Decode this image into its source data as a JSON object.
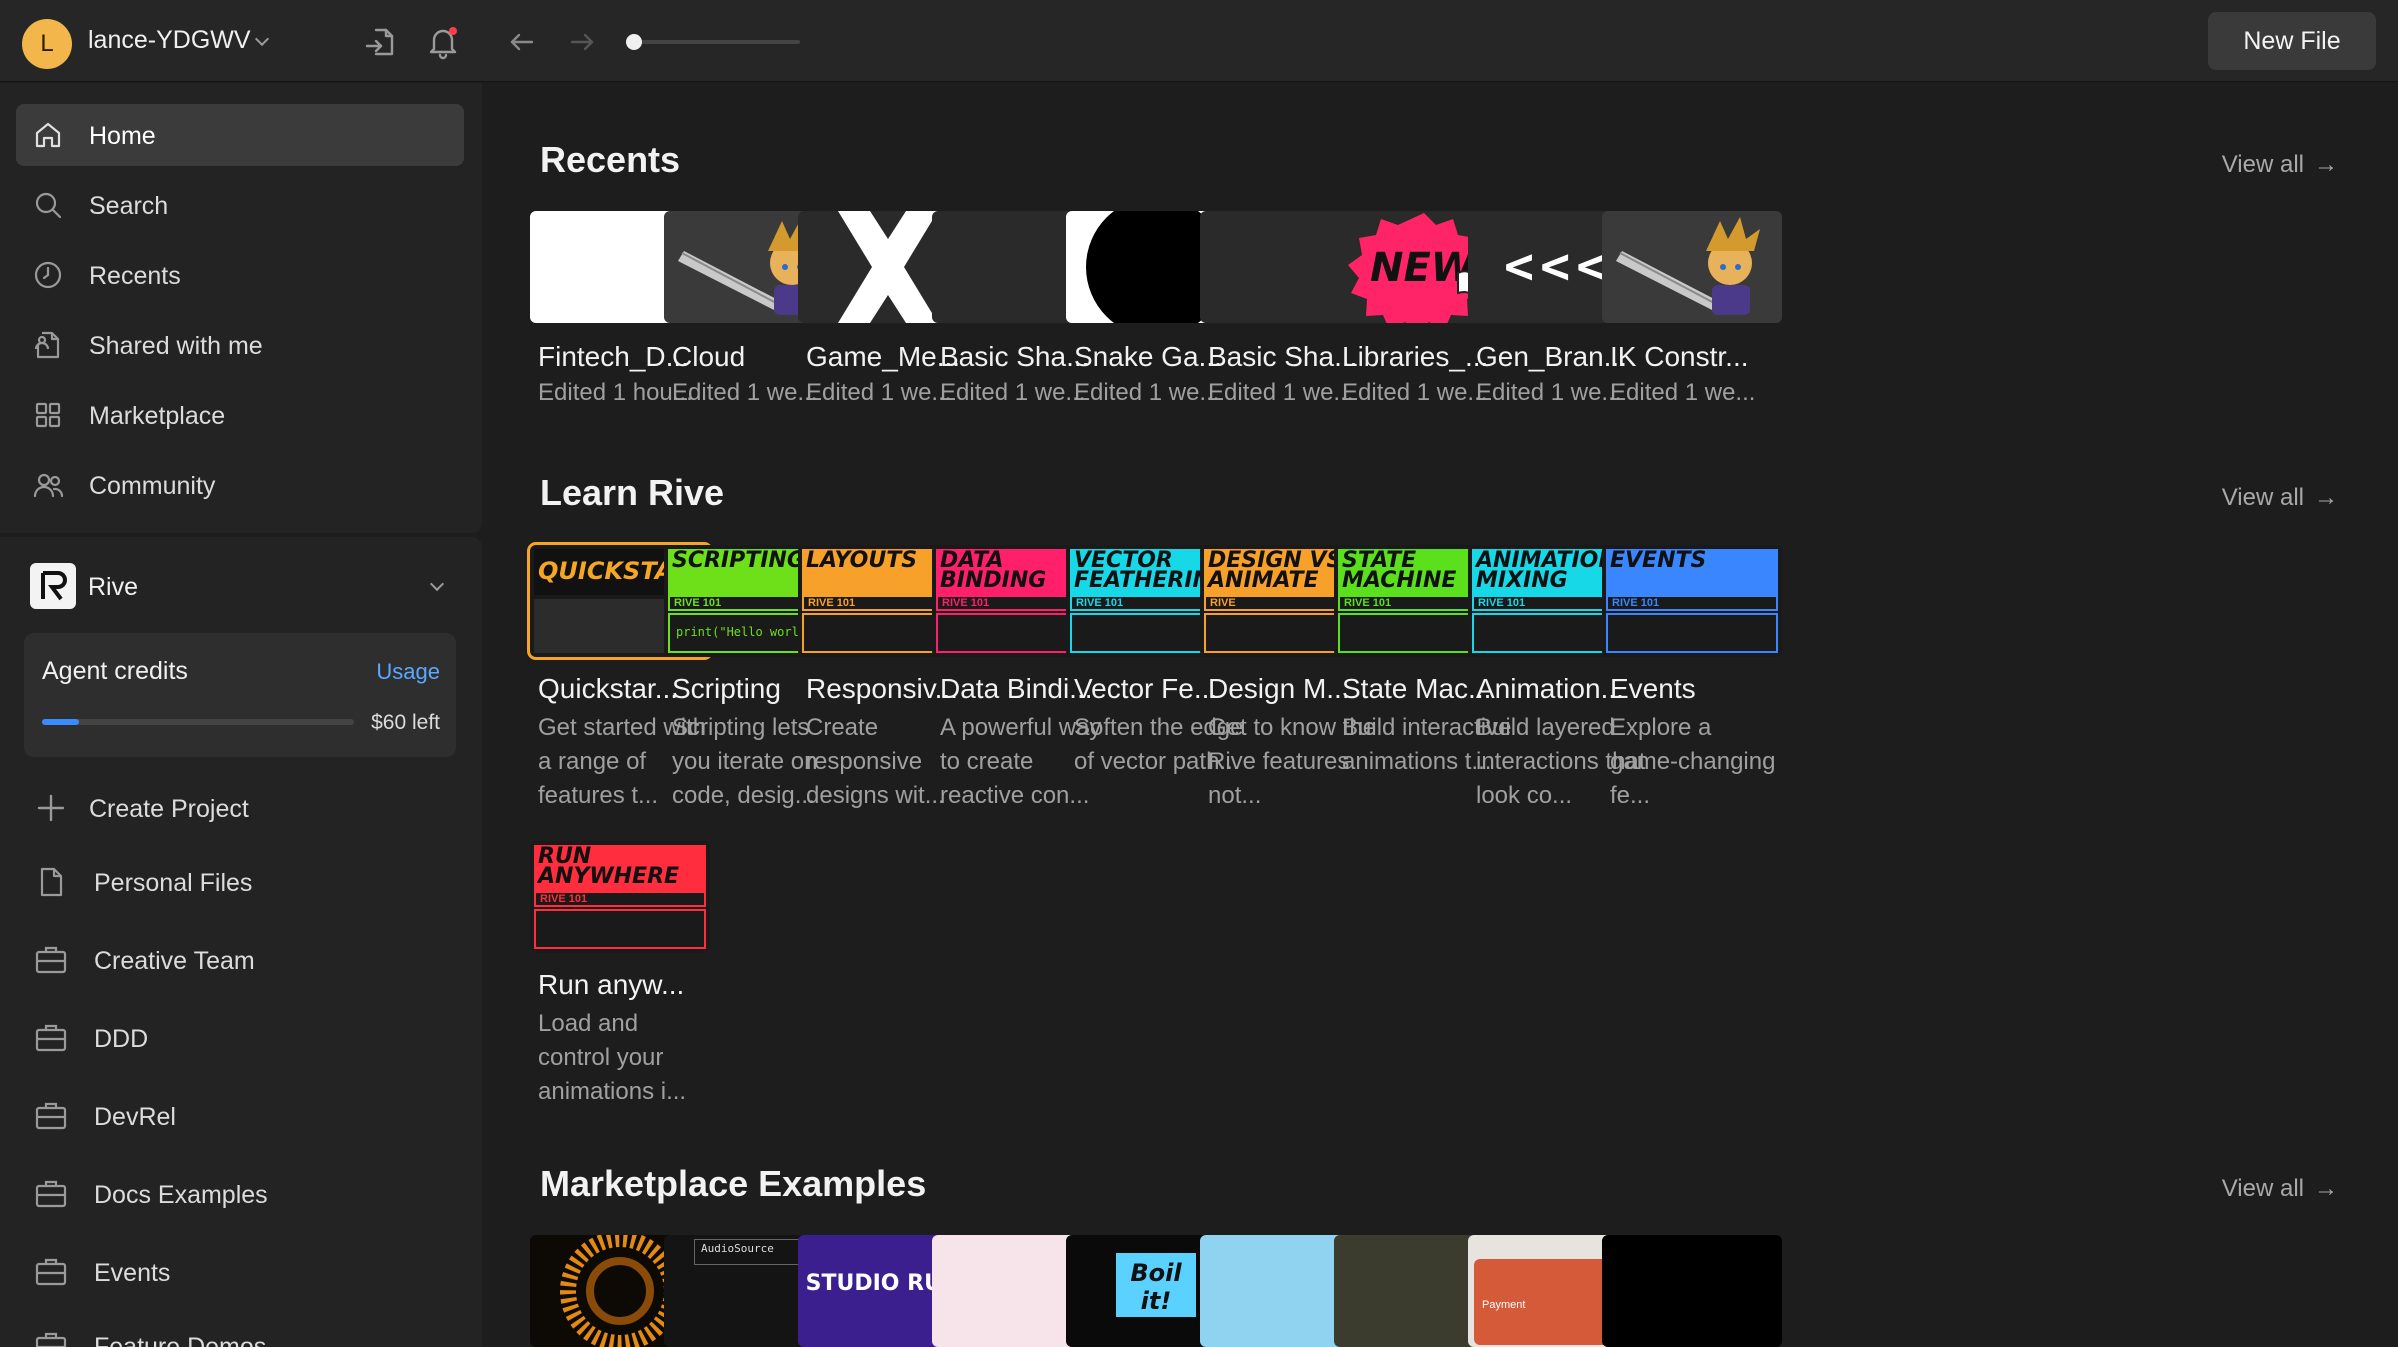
{
  "topbar": {
    "avatar_letter": "L",
    "username": "lance-YDGWV",
    "new_file": "New File",
    "history_progress": 0.05
  },
  "nav": [
    {
      "label": "Home",
      "icon": "home-icon",
      "active": true
    },
    {
      "label": "Search",
      "icon": "search-icon"
    },
    {
      "label": "Recents",
      "icon": "clock-icon"
    },
    {
      "label": "Shared with me",
      "icon": "shared-icon"
    },
    {
      "label": "Marketplace",
      "icon": "grid-icon"
    },
    {
      "label": "Community",
      "icon": "users-icon"
    }
  ],
  "workspace": {
    "name": "Rive",
    "credits": {
      "title": "Agent credits",
      "usage_link": "Usage",
      "remaining": "$60 left",
      "fraction_used": 0.12
    },
    "items": [
      "Create Project",
      "Personal Files",
      "Creative Team",
      "DDD",
      "DevRel",
      "Docs Examples",
      "Events",
      "Feature Demos"
    ]
  },
  "sections": {
    "recents": {
      "title": "Recents",
      "view_all": "View all"
    },
    "learn": {
      "title": "Learn Rive",
      "view_all": "View all"
    },
    "marketplace": {
      "title": "Marketplace Examples",
      "view_all": "View all"
    }
  },
  "recents": [
    {
      "title": "Fintech_D...",
      "sub": "Edited 1 hou...",
      "thumb": "white"
    },
    {
      "title": "Cloud",
      "sub": "Edited 1 we...",
      "thumb": "character"
    },
    {
      "title": "Game_Me...",
      "sub": "Edited 1 we...",
      "thumb": "x"
    },
    {
      "title": "Basic Sha...",
      "sub": "Edited 1 we...",
      "thumb": "blank"
    },
    {
      "title": "Snake Ga...",
      "sub": "Edited 1 we...",
      "thumb": "circle"
    },
    {
      "title": "Basic Sha...",
      "sub": "Edited 1 we...",
      "thumb": "blank"
    },
    {
      "title": "Libraries_...",
      "sub": "Edited 1 we...",
      "thumb": "new"
    },
    {
      "title": "Gen_Bran...",
      "sub": "Edited 1 we...",
      "thumb": "chevrons"
    },
    {
      "title": "IK Constr...",
      "sub": "Edited 1 we...",
      "thumb": "character"
    }
  ],
  "recents_thumb_text": {
    "new_badge": "NEW",
    "chevrons": "<<<"
  },
  "learn": [
    {
      "banner": "QUICKSTART",
      "title": "Quickstar...",
      "desc": "Get started with a range of features t...",
      "color": "#f5a623",
      "strip": "",
      "selected": true
    },
    {
      "banner": "SCRIPTING",
      "title": "Scripting",
      "desc": "Scripting lets you iterate on code, desig...",
      "color": "#6de01a",
      "strip": "RIVE 101",
      "code": "print(\"Hello world!\")"
    },
    {
      "banner": "LAYOUTS",
      "title": "Responsiv...",
      "desc": "Create responsive designs wit...",
      "color": "#f7a02a",
      "strip": "RIVE 101"
    },
    {
      "banner": "DATA BINDING",
      "title": "Data Bindi...",
      "desc": "A powerful way to create reactive con...",
      "color": "#ff1f6b",
      "strip": "RIVE 101"
    },
    {
      "banner": "VECTOR FEATHERING",
      "title": "Vector Fe...",
      "desc": "Soften the edge of vector path...",
      "color": "#17d8e6",
      "strip": "RIVE 101"
    },
    {
      "banner": "DESIGN VS ANIMATE",
      "title": "Design M...",
      "desc": "Get to know the Rive features not...",
      "color": "#f7a02a",
      "strip": "RIVE"
    },
    {
      "banner": "STATE MACHINE",
      "title": "State Mac...",
      "desc": "Build interactive animations t...",
      "color": "#5be01e",
      "strip": "RIVE 101"
    },
    {
      "banner": "ANIMATION MIXING",
      "title": "Animation...",
      "desc": "Build layered interactions that look co...",
      "color": "#17d8e6",
      "strip": "RIVE 101"
    },
    {
      "banner": "EVENTS",
      "title": "Events",
      "desc": "Explore a game-changing fe...",
      "color": "#3a86ff",
      "strip": "RIVE 101"
    },
    {
      "banner": "RUN ANYWHERE",
      "title": "Run anyw...",
      "desc": "Load and control your animations i...",
      "color": "#ff2d3d",
      "strip": "RIVE 101"
    }
  ],
  "marketplace_thumbs": [
    {
      "label": "",
      "bg": "#0d0a05"
    },
    {
      "label": "AudioSource",
      "bg": "#141414"
    },
    {
      "label": "STUDIO RUN!",
      "bg": "#3b1f8f"
    },
    {
      "label": "",
      "bg": "#f7e3ea"
    },
    {
      "label": "Boil it!",
      "bg": "#0a0a0a"
    },
    {
      "label": "",
      "bg": "#8fd3f0"
    },
    {
      "label": "",
      "bg": "#3c3c2e"
    },
    {
      "label": "Payment",
      "bg": "#e7e4e0"
    },
    {
      "label": "",
      "bg": "#000000"
    }
  ]
}
